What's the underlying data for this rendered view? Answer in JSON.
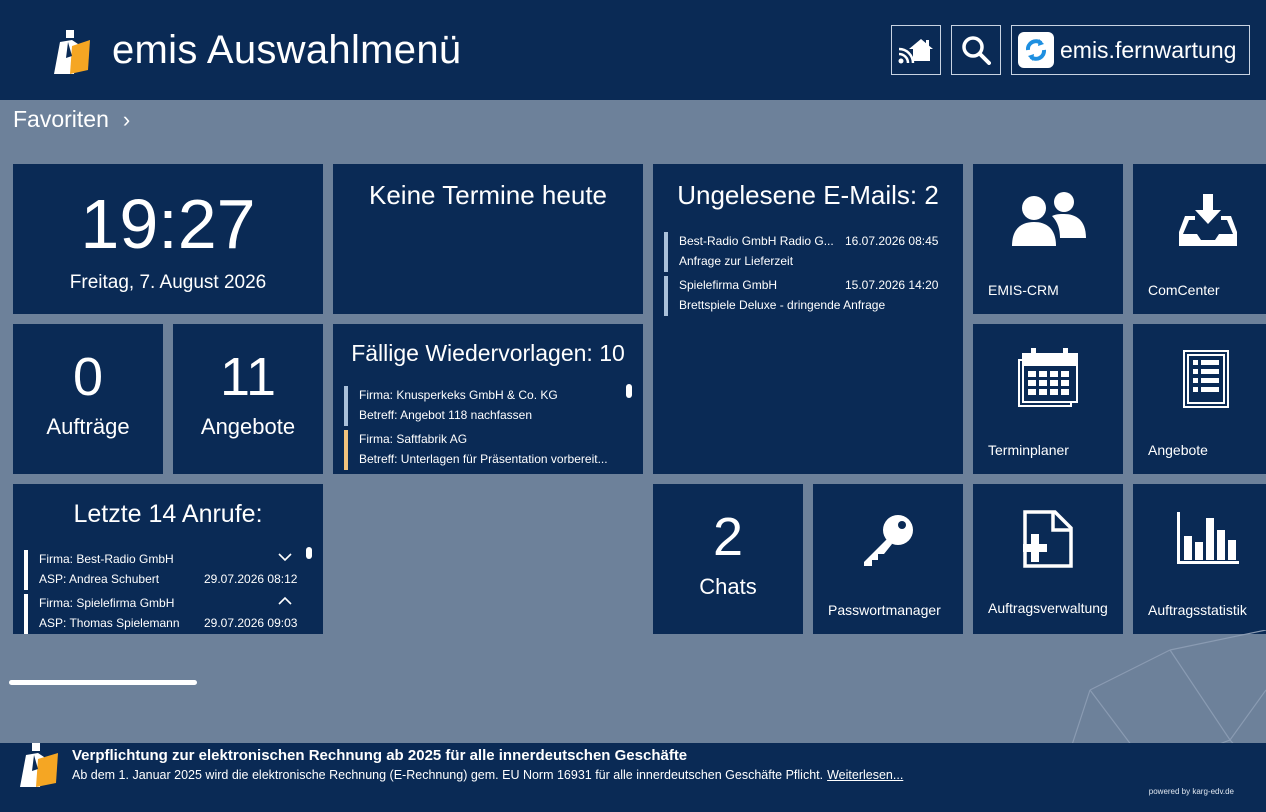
{
  "header": {
    "title": "emis Auswahlmenü",
    "remote_label": "emis.fernwartung",
    "home_icon": "remote-home-icon",
    "search_icon": "search-icon"
  },
  "favorites": {
    "label": "Favoriten"
  },
  "clock": {
    "time": "19:27",
    "date": "Freitag, 7. August 2026"
  },
  "appointments": {
    "title": "Keine Termine heute"
  },
  "emails": {
    "title": "Ungelesene E-Mails: 2",
    "items": [
      {
        "from": "Best-Radio GmbH Radio G...",
        "date": "16.07.2026 08:45",
        "subject": "Anfrage zur Lieferzeit"
      },
      {
        "from": "Spielefirma GmbH",
        "date": "15.07.2026 14:20",
        "subject": "Brettspiele Deluxe - dringende Anfrage"
      }
    ]
  },
  "orders": {
    "count": "0",
    "label": "Aufträge"
  },
  "quotes": {
    "count": "11",
    "label": "Angebote"
  },
  "followups": {
    "title": "Fällige Wiedervorlagen: 10",
    "items": [
      {
        "company": "Firma: Knusperkeks GmbH & Co. KG",
        "subject": "Betreff: Angebot 118 nachfassen",
        "color": "#a9c0da"
      },
      {
        "company": "Firma: Saftfabrik AG",
        "subject": "Betreff: Unterlagen für Präsentation vorbereit...",
        "color": "#f1c27d"
      }
    ]
  },
  "calls": {
    "title": "Letzte 14 Anrufe:",
    "items": [
      {
        "company": "Firma: Best-Radio GmbH",
        "contact": "ASP: Andrea Schubert",
        "date": "29.07.2026 08:12"
      },
      {
        "company": "Firma: Spielefirma GmbH",
        "contact": "ASP: Thomas Spielemann",
        "date": "29.07.2026 09:03"
      }
    ]
  },
  "chats": {
    "count": "2",
    "label": "Chats"
  },
  "apps": {
    "crm": "EMIS-CRM",
    "comcenter": "ComCenter",
    "terminplaner": "Terminplaner",
    "angebote": "Angebote",
    "passwort": "Passwortmanager",
    "auftragsverwaltung": "Auftragsverwaltung",
    "auftragsstatistik": "Auftragsstatistik"
  },
  "news": {
    "title": "Verpflichtung zur elektronischen Rechnung ab 2025 für alle innerdeutschen Geschäfte",
    "text": "Ab dem 1. Januar 2025 wird die  elektronische Rechnung (E-Rechnung) gem. EU Norm 16931 für alle innerdeutschen Geschäfte Pflicht.",
    "link": "Weiterlesen...",
    "powered": "powered by karg-edv.de"
  },
  "colors": {
    "header_bg": "#0a2a55",
    "tile_bg": "#0a2a55",
    "page_bg": "#6d819a",
    "accent_orange": "#f5a623"
  }
}
